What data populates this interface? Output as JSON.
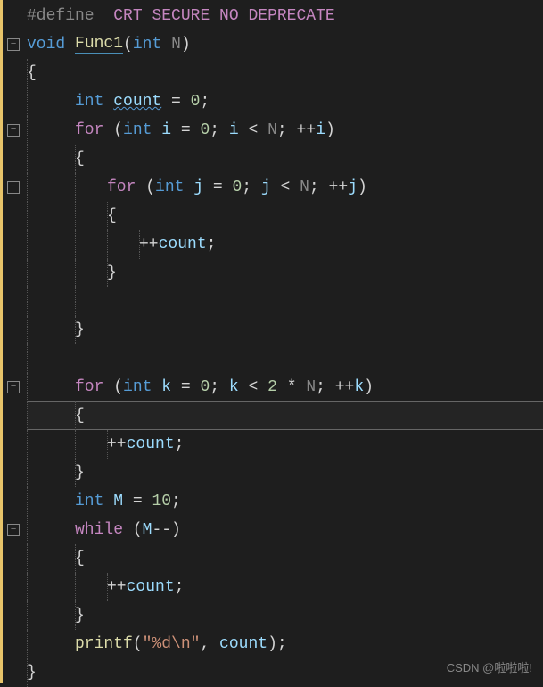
{
  "code": {
    "line1_define": "#define",
    "line1_macro": "_CRT_SECURE_NO_DEPRECATE",
    "line2_void": "void",
    "line2_func": "Func1",
    "line2_paren_open": "(",
    "line2_int": "int",
    "line2_param": "N",
    "line2_paren_close": ")",
    "line3_brace": "{",
    "line4_int": "int",
    "line4_var": "count",
    "line4_eq": " = ",
    "line4_zero": "0",
    "line4_semi": ";",
    "line5_for": "for",
    "line5_open": " (",
    "line5_int": "int",
    "line5_i": "i",
    "line5_eq": " = ",
    "line5_zero": "0",
    "line5_semi1": "; ",
    "line5_i2": "i",
    "line5_lt": " < ",
    "line5_N": "N",
    "line5_semi2": "; ",
    "line5_inc": "++",
    "line5_i3": "i",
    "line5_close": ")",
    "line6_brace": "{",
    "line7_for": "for",
    "line7_open": " (",
    "line7_int": "int",
    "line7_j": "j",
    "line7_eq": " = ",
    "line7_zero": "0",
    "line7_semi1": "; ",
    "line7_j2": "j",
    "line7_lt": " < ",
    "line7_N": "N",
    "line7_semi2": "; ",
    "line7_inc": "++",
    "line7_j3": "j",
    "line7_close": ")",
    "line8_brace": "{",
    "line9_inc": "++",
    "line9_count": "count",
    "line9_semi": ";",
    "line10_brace": "}",
    "line11_brace": "}",
    "line12_for": "for",
    "line12_open": " (",
    "line12_int": "int",
    "line12_k": "k",
    "line12_eq": " = ",
    "line12_zero": "0",
    "line12_semi1": "; ",
    "line12_k2": "k",
    "line12_lt": " < ",
    "line12_two": "2",
    "line12_mul": " * ",
    "line12_N": "N",
    "line12_semi2": "; ",
    "line12_inc": "++",
    "line12_k3": "k",
    "line12_close": ")",
    "line13_brace": "{",
    "line14_inc": "++",
    "line14_count": "count",
    "line14_semi": ";",
    "line15_brace": "}",
    "line16_int": "int",
    "line16_M": "M",
    "line16_eq": " = ",
    "line16_ten": "10",
    "line16_semi": ";",
    "line17_while": "while",
    "line17_open": " (",
    "line17_M": "M",
    "line17_dec": "--",
    "line17_close": ")",
    "line18_brace": "{",
    "line19_inc": "++",
    "line19_count": "count",
    "line19_semi": ";",
    "line20_brace": "}",
    "line21_printf": "printf",
    "line21_open": "(",
    "line21_str": "\"%d\\n\"",
    "line21_comma": ", ",
    "line21_count": "count",
    "line21_close": ")",
    "line21_semi": ";",
    "line22_brace": "}"
  },
  "fold_minus": "−",
  "watermark": "CSDN @啦啦啦!"
}
